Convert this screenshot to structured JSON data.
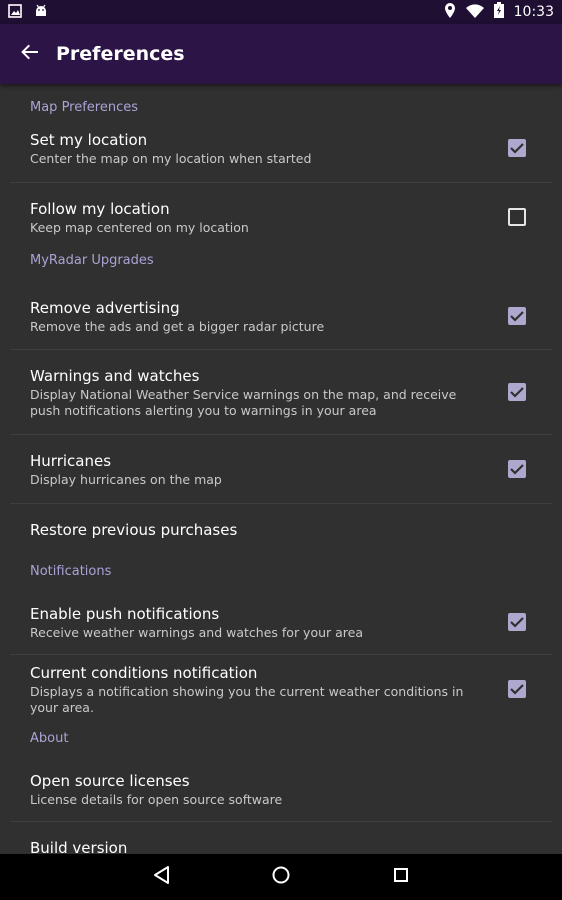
{
  "status_bar": {
    "time": "10:33",
    "icons_left": [
      "image-icon",
      "android-icon"
    ],
    "icons_right": [
      "location-icon",
      "wifi-icon",
      "battery-icon"
    ]
  },
  "toolbar": {
    "title": "Preferences",
    "back_icon": "arrow-back-icon",
    "background": "#2d1446"
  },
  "accent_color": "#a9a3d6",
  "sections": [
    {
      "header": "Map Preferences",
      "items": [
        {
          "title": "Set my location",
          "summary": "Center the map on my location when started",
          "checked": true
        },
        {
          "title": "Follow my location",
          "summary": "Keep map centered on my location",
          "checked": false
        }
      ]
    },
    {
      "header": "MyRadar Upgrades",
      "items": [
        {
          "title": "Remove advertising",
          "summary": "Remove the ads and get a bigger radar picture",
          "checked": true
        },
        {
          "title": "Warnings and watches",
          "summary": "Display National Weather Service warnings on the map, and receive push notifications alerting you to warnings in your area",
          "checked": true
        },
        {
          "title": "Hurricanes",
          "summary": "Display hurricanes on the map",
          "checked": true
        },
        {
          "title": "Restore previous purchases"
        }
      ]
    },
    {
      "header": "Notifications",
      "items": [
        {
          "title": "Enable push notifications",
          "summary": "Receive weather warnings and watches for your area",
          "checked": true
        },
        {
          "title": "Current conditions notification",
          "summary": "Displays a notification showing you the current weather conditions in your area.",
          "checked": true
        }
      ]
    },
    {
      "header": "About",
      "items": [
        {
          "title": "Open source licenses",
          "summary": "License details for open source software"
        },
        {
          "title": "Build version"
        }
      ]
    }
  ],
  "nav_bar": [
    "back-triangle-icon",
    "home-circle-icon",
    "recents-square-icon"
  ]
}
